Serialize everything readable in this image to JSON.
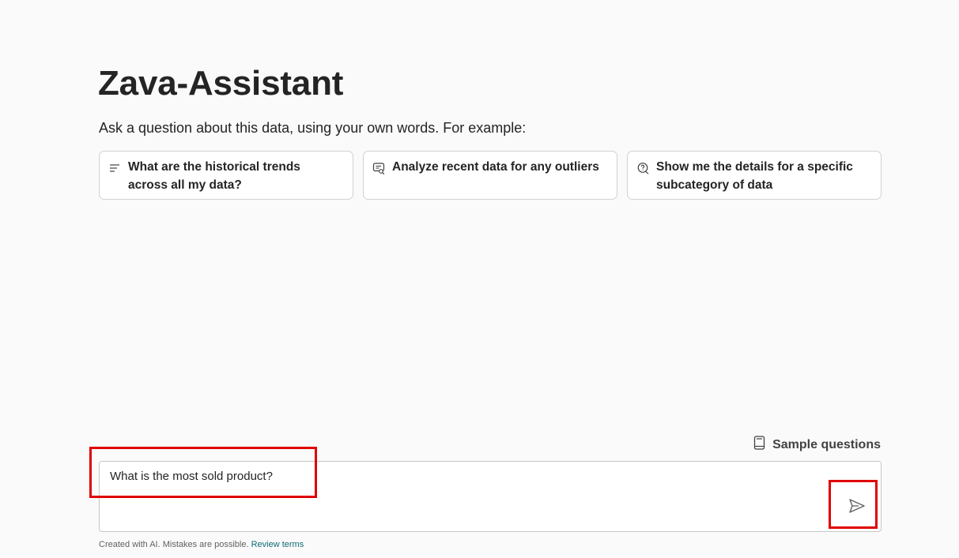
{
  "header": {
    "title": "Zava-Assistant",
    "subtitle": "Ask a question about this data, using your own words. For example:"
  },
  "suggestions": [
    {
      "icon": "lines-icon",
      "text": "What are the historical trends across all my data?"
    },
    {
      "icon": "chat-search-icon",
      "text": "Analyze recent data for any outliers"
    },
    {
      "icon": "question-bubble-icon",
      "text": "Show me the details for a specific subcategory of data"
    }
  ],
  "sample_questions": {
    "icon": "book-icon",
    "label": "Sample questions"
  },
  "input": {
    "value": "What is the most sold product?",
    "send_icon": "send-icon"
  },
  "footer": {
    "disclaimer": "Created with AI. Mistakes are possible.",
    "link": "Review terms"
  },
  "colors": {
    "background": "#fafafa",
    "highlight": "#e00000",
    "link": "#0f6b74"
  }
}
